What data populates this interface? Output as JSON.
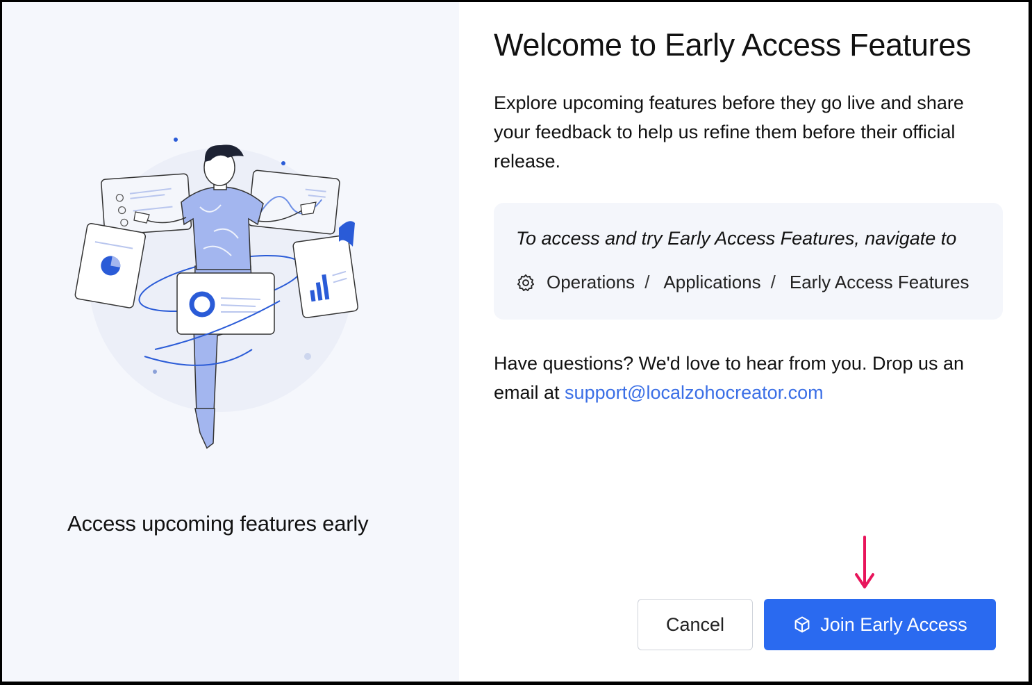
{
  "left": {
    "caption": "Access upcoming features early"
  },
  "header": {
    "title": "Welcome to Early Access Features"
  },
  "description": "Explore upcoming features before they go live and share your feedback to help us refine them before their official release.",
  "navigation": {
    "intro": "To access and try Early Access Features, navigate to",
    "path": [
      "Operations",
      "Applications",
      "Early Access Features"
    ],
    "separator": "/"
  },
  "support": {
    "text": "Have questions? We'd love to hear from you. Drop us an email at ",
    "email": "support@localzohocreator.com"
  },
  "actions": {
    "cancel_label": "Cancel",
    "join_label": "Join Early Access"
  },
  "colors": {
    "primary": "#2a6af0",
    "link": "#3b6fe6",
    "annotation_arrow": "#e8155b"
  }
}
